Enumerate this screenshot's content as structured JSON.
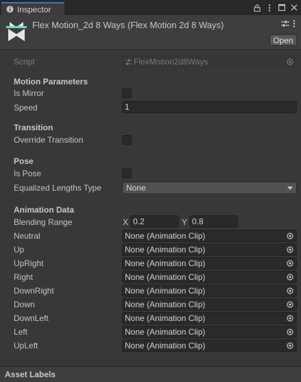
{
  "tab": {
    "title": "Inspector",
    "icon": "info-icon"
  },
  "window_icons": [
    "lock-icon",
    "menu-icon",
    "maximize-icon",
    "close-icon"
  ],
  "header": {
    "title": "Flex Motion_2d 8 Ways (Flex Motion 2d 8 Ways)",
    "icon": "flex-motion-icon",
    "settings_icon": "sliders-icon",
    "open_label": "Open"
  },
  "script": {
    "label": "Script",
    "value": "FlexMotion2d8Ways"
  },
  "motion_parameters": {
    "title": "Motion Parameters",
    "is_mirror_label": "Is Mirror",
    "is_mirror": false,
    "speed_label": "Speed",
    "speed": "1"
  },
  "transition": {
    "title": "Transition",
    "override_label": "Override Transition",
    "override": false
  },
  "pose": {
    "title": "Pose",
    "is_pose_label": "Is Pose",
    "is_pose": false,
    "equalized_label": "Equalized Lengths Type",
    "equalized_value": "None"
  },
  "animation_data": {
    "title": "Animation Data",
    "blending_label": "Blending Range",
    "x_label": "X",
    "x_value": "0.2",
    "y_label": "Y",
    "y_value": "0.8",
    "clips": [
      {
        "label": "Neutral",
        "value": "None (Animation Clip)"
      },
      {
        "label": "Up",
        "value": "None (Animation Clip)"
      },
      {
        "label": "UpRight",
        "value": "None (Animation Clip)"
      },
      {
        "label": "Right",
        "value": "None (Animation Clip)"
      },
      {
        "label": "DownRight",
        "value": "None (Animation Clip)"
      },
      {
        "label": "Down",
        "value": "None (Animation Clip)"
      },
      {
        "label": "DownLeft",
        "value": "None (Animation Clip)"
      },
      {
        "label": "Left",
        "value": "None (Animation Clip)"
      },
      {
        "label": "UpLeft",
        "value": "None (Animation Clip)"
      }
    ]
  },
  "footer": {
    "label": "Asset Labels"
  }
}
